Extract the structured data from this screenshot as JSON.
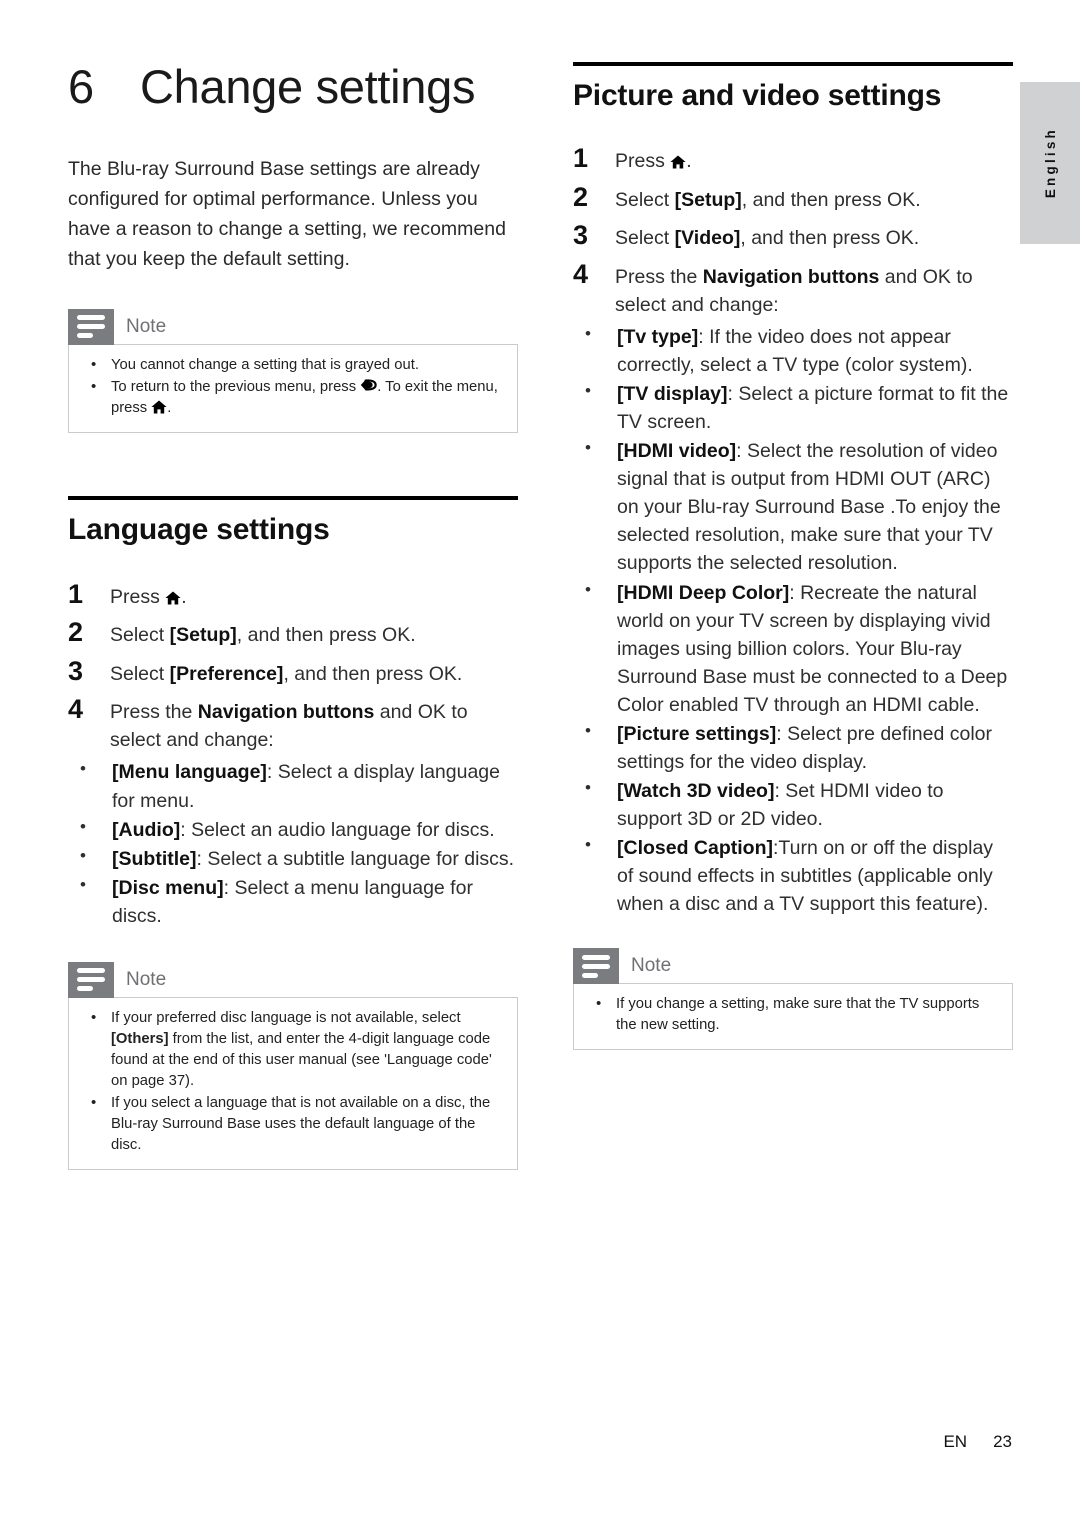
{
  "side_tab": {
    "label": "English"
  },
  "left_column": {
    "chapter": {
      "number": "6",
      "title": "Change settings"
    },
    "intro": "The Blu-ray Surround Base  settings are already configured for optimal performance. Unless you have a reason to change a setting, we recommend that you keep the default setting.",
    "note_top": {
      "title": "Note",
      "items": [
        {
          "prefix": "You cannot change a setting that is grayed out.",
          "icon1": null,
          "middle": null,
          "icon2": null,
          "suffix": null
        },
        {
          "prefix": "To return to the previous menu, press ",
          "icon1": "back-arrow-icon",
          "middle": ". To exit the menu, press ",
          "icon2": "home-icon",
          "suffix": "."
        }
      ]
    },
    "section": {
      "title": "Language settings",
      "steps": [
        {
          "number": "1",
          "pre": "Press ",
          "icon": "home-icon",
          "post": "."
        },
        {
          "number": "2",
          "pre": "Select ",
          "bold": "[Setup]",
          "post": ", and then press OK."
        },
        {
          "number": "3",
          "pre": "Select ",
          "bold": "[Preference]",
          "post": ", and then press OK."
        },
        {
          "number": "4",
          "pre": "Press the ",
          "bold": "Navigation buttons",
          "post": " and OK to select and change:"
        }
      ],
      "bullets": [
        {
          "term": "[Menu language]",
          "desc": ": Select a display language for menu."
        },
        {
          "term": "[Audio]",
          "desc": ": Select an audio language for discs."
        },
        {
          "term": "[Subtitle]",
          "desc": ": Select a subtitle language for discs."
        },
        {
          "term": "[Disc menu]",
          "desc": ": Select a menu language for discs."
        }
      ]
    },
    "note_bottom": {
      "title": "Note",
      "items": [
        {
          "pre": "If your preferred disc language is not available, select ",
          "bold": "[Others]",
          "post": " from the list, and enter the 4-digit language code found at the end of this user manual (see 'Language code' on page 37)."
        },
        {
          "pre": "If you select a language that is not available on a disc, the Blu-ray Surround Base  uses the default language of the disc.",
          "bold": null,
          "post": null
        }
      ]
    }
  },
  "right_column": {
    "section": {
      "title": "Picture and video settings",
      "steps": [
        {
          "number": "1",
          "pre": "Press ",
          "icon": "home-icon",
          "post": "."
        },
        {
          "number": "2",
          "pre": "Select ",
          "bold": "[Setup]",
          "post": ", and then press OK."
        },
        {
          "number": "3",
          "pre": "Select ",
          "bold": "[Video]",
          "post": ", and then press OK."
        },
        {
          "number": "4",
          "pre": "Press the ",
          "bold": "Navigation buttons",
          "post": " and OK to select and change:"
        }
      ],
      "bullets": [
        {
          "term": "[Tv type]",
          "desc": ": If the video does not appear correctly, select a TV type (color system)."
        },
        {
          "term": "[TV display]",
          "desc": ": Select a picture format to fit the TV screen."
        },
        {
          "term": "[HDMI video]",
          "desc": ": Select the resolution of video signal that is output from HDMI OUT (ARC) on your Blu-ray Surround Base .To enjoy the selected resolution, make sure that your TV supports the selected resolution."
        },
        {
          "term": "[HDMI Deep Color]",
          "desc": ": Recreate the natural world on your TV screen by displaying vivid images using billion colors. Your Blu-ray Surround Base must be connected to a Deep Color enabled TV through an HDMI cable."
        },
        {
          "term": "[Picture settings]",
          "desc": ": Select pre defined color settings for the video display."
        },
        {
          "term": "[Watch 3D video]",
          "desc": ": Set HDMI video to support 3D or 2D video."
        },
        {
          "term": "[Closed Caption]",
          "desc": ":Turn on or off the display of sound effects in subtitles (applicable only when a disc and a TV support this feature)."
        }
      ]
    },
    "note": {
      "title": "Note",
      "items": [
        {
          "pre": "If you change a setting, make sure that the TV supports the new setting.",
          "bold": null,
          "post": null
        }
      ]
    }
  },
  "footer": {
    "language_code": "EN",
    "page_number": "23"
  },
  "colors": {
    "tab_background": "#cfd1d3",
    "note_icon_background": "#7b7c80",
    "note_title_text": "#6e7073",
    "note_border": "#c9cbcd",
    "rule": "#000000"
  }
}
